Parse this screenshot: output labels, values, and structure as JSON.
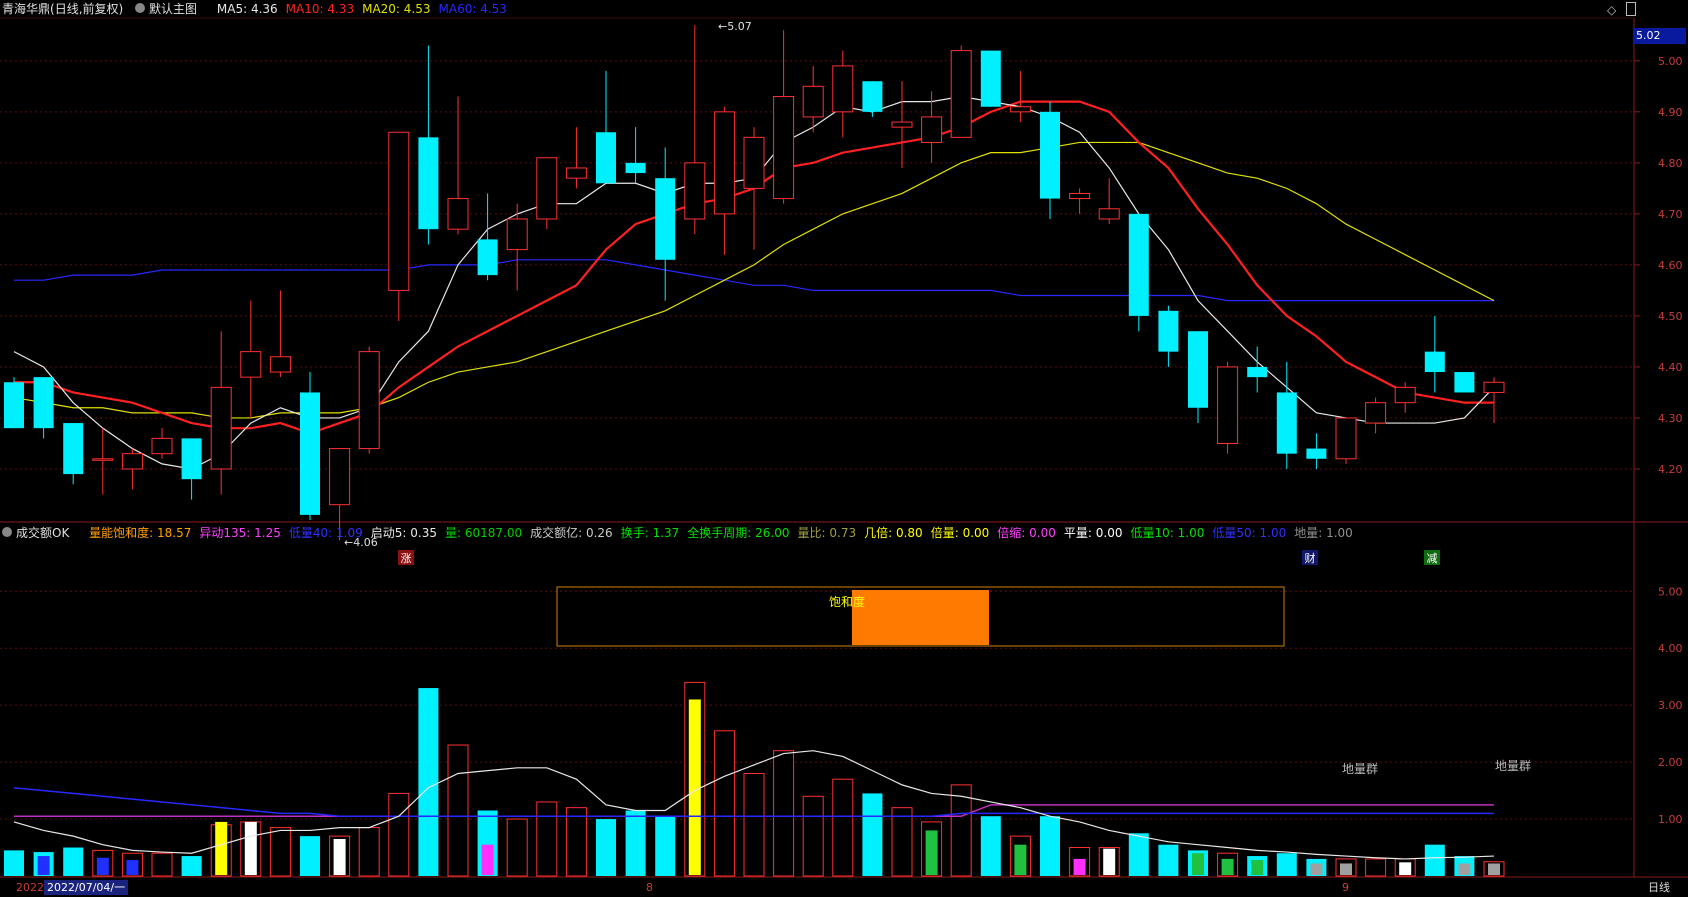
{
  "main": {
    "stock": "青海华鼎",
    "period": "(日线,前复权)",
    "template": "默认主图",
    "ma": [
      {
        "label": "MA5:",
        "value": "4.36",
        "color": "#e8e8e8"
      },
      {
        "label": "MA10:",
        "value": "4.33",
        "color": "#ff2020"
      },
      {
        "label": "MA20:",
        "value": "4.53",
        "color": "#e0e000"
      },
      {
        "label": "MA60:",
        "value": "4.53",
        "color": "#2828ff"
      }
    ],
    "current_price": "5.02",
    "high_mark": "5.07",
    "low_mark": "4.06",
    "markers": [
      "涨",
      "财",
      "减"
    ],
    "y_ticks": [
      "5.00",
      "4.90",
      "4.80",
      "4.70",
      "4.60",
      "4.50",
      "4.40",
      "4.30",
      "4.20"
    ]
  },
  "sub": {
    "title": "成交额OK",
    "items": [
      {
        "label": "量能饱和度:",
        "value": "18.57",
        "color": "#ffa000"
      },
      {
        "label": "异动135:",
        "value": "1.25",
        "color": "#ff40ff"
      },
      {
        "label": "低量40:",
        "value": "1.09",
        "color": "#3030ff"
      },
      {
        "label": "启动5:",
        "value": "0.35",
        "color": "#e8e8e8"
      },
      {
        "label": "量:",
        "value": "60187.00",
        "color": "#00d000"
      },
      {
        "label": "成交额亿:",
        "value": "0.26",
        "color": "#cccccc"
      },
      {
        "label": "换手:",
        "value": "1.37",
        "color": "#00e000"
      },
      {
        "label": "全换手周期:",
        "value": "26.00",
        "color": "#00e000"
      },
      {
        "label": "量比:",
        "value": "0.73",
        "color": "#a0a040"
      },
      {
        "label": "几倍:",
        "value": "0.80",
        "color": "#ffff00"
      },
      {
        "label": "倍量:",
        "value": "0.00",
        "color": "#ffff00"
      },
      {
        "label": "倍缩:",
        "value": "0.00",
        "color": "#ff40ff"
      },
      {
        "label": "平量:",
        "value": "0.00",
        "color": "#ffffff"
      },
      {
        "label": "低量10:",
        "value": "1.00",
        "color": "#00e000"
      },
      {
        "label": "低量50:",
        "value": "1.00",
        "color": "#3030ff"
      },
      {
        "label": "地量:",
        "value": "1.00",
        "color": "#909090"
      }
    ],
    "saturation_label": "饱和度",
    "ground_volume_label": "地量群",
    "y_ticks": [
      "5.00",
      "4.00",
      "3.00",
      "2.00",
      "1.00"
    ]
  },
  "footer": {
    "year": "2022",
    "date": "2022/07/04/一",
    "month8": "8",
    "month9": "9",
    "period_button": "日线"
  },
  "chart_data": {
    "type": "candlestick",
    "series_ohlc": [
      [
        4.37,
        4.38,
        4.28,
        4.28
      ],
      [
        4.38,
        4.38,
        4.26,
        4.28
      ],
      [
        4.29,
        4.29,
        4.17,
        4.19
      ],
      [
        4.22,
        4.28,
        4.15,
        4.22
      ],
      [
        4.2,
        4.24,
        4.16,
        4.23
      ],
      [
        4.23,
        4.28,
        4.22,
        4.26
      ],
      [
        4.26,
        4.26,
        4.14,
        4.18
      ],
      [
        4.2,
        4.47,
        4.15,
        4.36
      ],
      [
        4.38,
        4.53,
        4.3,
        4.43
      ],
      [
        4.39,
        4.55,
        4.38,
        4.42
      ],
      [
        4.35,
        4.39,
        4.1,
        4.11
      ],
      [
        4.13,
        4.24,
        4.06,
        4.24
      ],
      [
        4.24,
        4.44,
        4.23,
        4.43
      ],
      [
        4.55,
        4.86,
        4.49,
        4.86
      ],
      [
        4.85,
        5.03,
        4.64,
        4.67
      ],
      [
        4.67,
        4.93,
        4.66,
        4.73
      ],
      [
        4.65,
        4.74,
        4.57,
        4.58
      ],
      [
        4.63,
        4.72,
        4.55,
        4.69
      ],
      [
        4.69,
        4.81,
        4.67,
        4.81
      ],
      [
        4.77,
        4.87,
        4.75,
        4.79
      ],
      [
        4.86,
        4.98,
        4.79,
        4.76
      ],
      [
        4.8,
        4.87,
        4.76,
        4.78
      ],
      [
        4.77,
        4.83,
        4.53,
        4.61
      ],
      [
        4.69,
        5.07,
        4.66,
        4.8
      ],
      [
        4.7,
        4.91,
        4.62,
        4.9
      ],
      [
        4.75,
        4.87,
        4.63,
        4.85
      ],
      [
        4.73,
        5.06,
        4.72,
        4.93
      ],
      [
        4.89,
        4.99,
        4.86,
        4.95
      ],
      [
        4.9,
        5.02,
        4.85,
        4.99
      ],
      [
        4.96,
        4.96,
        4.89,
        4.9
      ],
      [
        4.87,
        4.96,
        4.79,
        4.88
      ],
      [
        4.84,
        4.94,
        4.8,
        4.89
      ],
      [
        4.85,
        5.03,
        4.85,
        5.02
      ],
      [
        5.02,
        5.02,
        4.91,
        4.91
      ],
      [
        4.9,
        4.98,
        4.88,
        4.91
      ],
      [
        4.9,
        4.92,
        4.69,
        4.73
      ],
      [
        4.73,
        4.75,
        4.7,
        4.74
      ],
      [
        4.69,
        4.77,
        4.68,
        4.71
      ],
      [
        4.7,
        4.7,
        4.47,
        4.5
      ],
      [
        4.51,
        4.52,
        4.4,
        4.43
      ],
      [
        4.47,
        4.47,
        4.29,
        4.32
      ],
      [
        4.25,
        4.41,
        4.23,
        4.4
      ],
      [
        4.4,
        4.44,
        4.35,
        4.38
      ],
      [
        4.35,
        4.41,
        4.2,
        4.23
      ],
      [
        4.24,
        4.27,
        4.2,
        4.22
      ],
      [
        4.22,
        4.3,
        4.21,
        4.3
      ],
      [
        4.29,
        4.34,
        4.27,
        4.33
      ],
      [
        4.33,
        4.37,
        4.31,
        4.36
      ],
      [
        4.43,
        4.5,
        4.35,
        4.39
      ],
      [
        4.39,
        4.39,
        4.35,
        4.35
      ],
      [
        4.35,
        4.38,
        4.29,
        4.37
      ]
    ],
    "volume": [
      0.45,
      0.42,
      0.5,
      0.45,
      0.4,
      0.4,
      0.35,
      0.9,
      0.95,
      0.85,
      0.7,
      0.7,
      0.85,
      1.45,
      3.3,
      2.3,
      1.15,
      1.0,
      1.3,
      1.2,
      1.0,
      1.15,
      1.05,
      3.4,
      2.55,
      1.8,
      2.2,
      1.4,
      1.7,
      1.45,
      1.2,
      0.95,
      1.6,
      1.05,
      0.7,
      1.05,
      0.5,
      0.5,
      0.75,
      0.55,
      0.45,
      0.4,
      0.35,
      0.4,
      0.3,
      0.3,
      0.3,
      0.3,
      0.55,
      0.35,
      0.25
    ],
    "ma5": [
      4.43,
      4.4,
      4.33,
      4.28,
      4.24,
      4.21,
      4.2,
      4.23,
      4.29,
      4.32,
      4.3,
      4.3,
      4.32,
      4.41,
      4.47,
      4.6,
      4.67,
      4.7,
      4.72,
      4.72,
      4.76,
      4.76,
      4.74,
      4.76,
      4.76,
      4.77,
      4.84,
      4.87,
      4.91,
      4.9,
      4.92,
      4.92,
      4.93,
      4.92,
      4.91,
      4.89,
      4.86,
      4.79,
      4.7,
      4.63,
      4.53,
      4.47,
      4.41,
      4.36,
      4.31,
      4.3,
      4.29,
      4.29,
      4.29,
      4.3,
      4.36
    ],
    "ma10": [
      4.37,
      4.37,
      4.35,
      4.34,
      4.33,
      4.31,
      4.29,
      4.28,
      4.28,
      4.29,
      4.27,
      4.29,
      4.31,
      4.36,
      4.4,
      4.44,
      4.47,
      4.5,
      4.53,
      4.56,
      4.63,
      4.68,
      4.7,
      4.72,
      4.73,
      4.75,
      4.79,
      4.8,
      4.82,
      4.83,
      4.84,
      4.85,
      4.87,
      4.9,
      4.92,
      4.92,
      4.92,
      4.9,
      4.84,
      4.79,
      4.71,
      4.64,
      4.56,
      4.5,
      4.46,
      4.41,
      4.38,
      4.35,
      4.34,
      4.33,
      4.33
    ],
    "ma20": [
      4.34,
      4.33,
      4.32,
      4.32,
      4.31,
      4.31,
      4.31,
      4.3,
      4.3,
      4.31,
      4.31,
      4.31,
      4.32,
      4.34,
      4.37,
      4.39,
      4.4,
      4.41,
      4.43,
      4.45,
      4.47,
      4.49,
      4.51,
      4.54,
      4.57,
      4.6,
      4.64,
      4.67,
      4.7,
      4.72,
      4.74,
      4.77,
      4.8,
      4.82,
      4.82,
      4.83,
      4.84,
      4.84,
      4.84,
      4.82,
      4.8,
      4.78,
      4.77,
      4.75,
      4.72,
      4.68,
      4.65,
      4.62,
      4.59,
      4.56,
      4.53
    ],
    "ma60": [
      4.57,
      4.57,
      4.58,
      4.58,
      4.58,
      4.59,
      4.59,
      4.59,
      4.59,
      4.59,
      4.59,
      4.59,
      4.59,
      4.59,
      4.6,
      4.6,
      4.6,
      4.61,
      4.61,
      4.61,
      4.61,
      4.6,
      4.59,
      4.58,
      4.57,
      4.56,
      4.56,
      4.55,
      4.55,
      4.55,
      4.55,
      4.55,
      4.55,
      4.55,
      4.54,
      4.54,
      4.54,
      4.54,
      4.54,
      4.54,
      4.54,
      4.53,
      4.53,
      4.53,
      4.53,
      4.53,
      4.53,
      4.53,
      4.53,
      4.53,
      4.53
    ],
    "ylim": [
      4.1,
      5.08
    ],
    "volume_ylim": [
      0,
      5.9
    ]
  }
}
